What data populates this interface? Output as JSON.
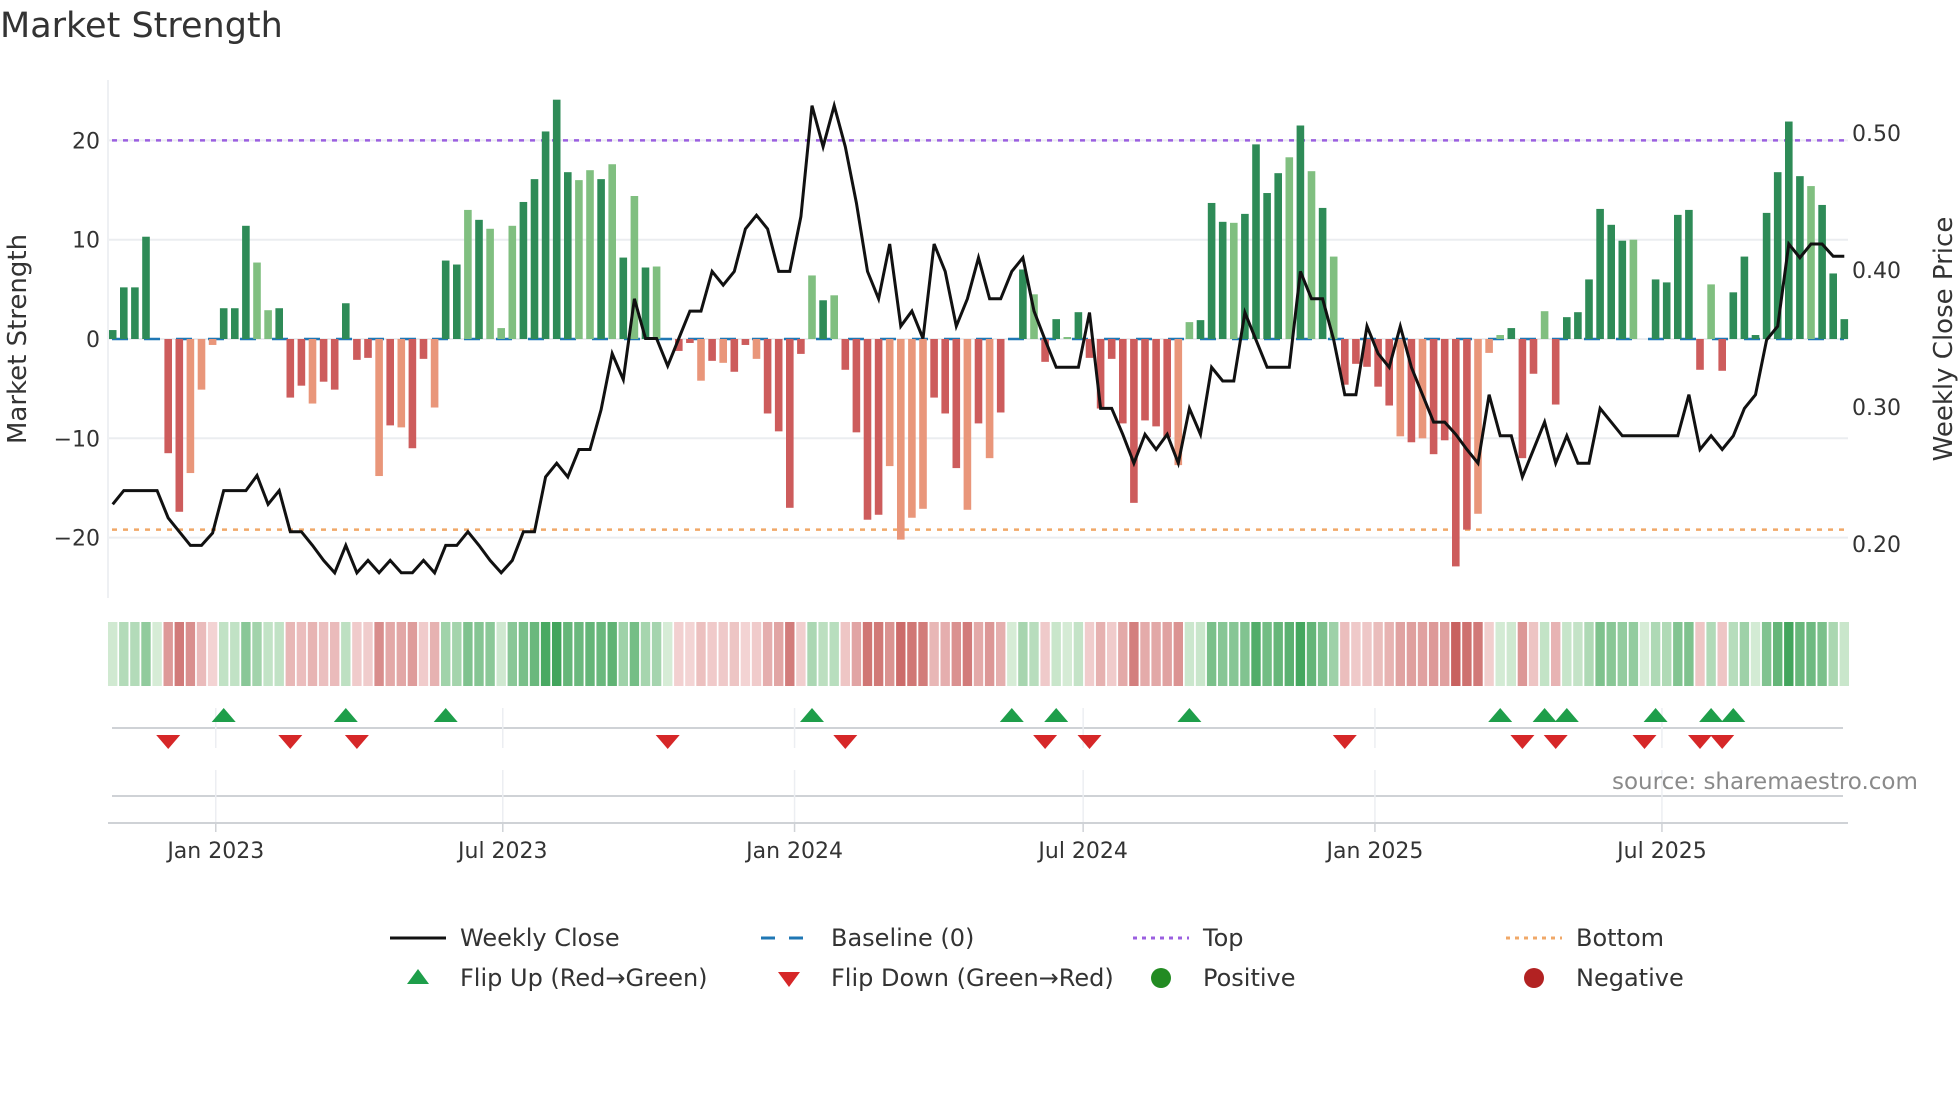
{
  "title": "Market Strength",
  "source": "source: sharemaestro.com",
  "colors": {
    "bar_pos_strong": "#2e8b57",
    "bar_pos_weak": "#80bf80",
    "bar_neg_strong": "#cd5c5c",
    "bar_neg_weak": "#e9967a",
    "line": "#111111",
    "baseline": "#1f77b4",
    "top": "#9b5fe0",
    "bottom": "#f0a868",
    "flip_up": "#1e9e4a",
    "flip_down": "#d62728",
    "positive": "#228b22",
    "negative": "#b22222",
    "grid": "#ebedf0"
  },
  "chart_data": {
    "type": "bar+line",
    "title": "Market Strength",
    "ylabel": "Market Strength",
    "y2label": "Weekly Close Price",
    "ylim": [
      -26.5,
      26.5
    ],
    "y2lim": [
      0.155,
      0.545
    ],
    "yticks": [
      {
        "value": 20,
        "label": "20"
      },
      {
        "value": 10,
        "label": "10"
      },
      {
        "value": 0,
        "label": "0"
      },
      {
        "value": -10,
        "label": "−10"
      },
      {
        "value": -20,
        "label": "−20"
      }
    ],
    "y2ticks": [
      {
        "value": 0.5,
        "label": "0.50"
      },
      {
        "value": 0.4,
        "label": "0.40"
      },
      {
        "value": 0.3,
        "label": "0.30"
      },
      {
        "value": 0.2,
        "label": "0.20"
      }
    ],
    "xticks": [
      {
        "date": "2023-01-01",
        "label": "Jan 2023"
      },
      {
        "date": "2023-07-01",
        "label": "Jul 2023"
      },
      {
        "date": "2024-01-01",
        "label": "Jan 2024"
      },
      {
        "date": "2024-07-01",
        "label": "Jul 2024"
      },
      {
        "date": "2025-01-01",
        "label": "Jan 2025"
      },
      {
        "date": "2025-07-01",
        "label": "Jul 2025"
      }
    ],
    "start_date": "2022-10-28",
    "interval_days": 7,
    "top_level": 20,
    "bottom_level": -19.2,
    "baseline": 0,
    "strength": [
      0.9,
      5.2,
      5.2,
      10.3,
      0,
      -11.5,
      -17.4,
      -13.5,
      -5.1,
      -0.6,
      3.1,
      3.1,
      11.4,
      7.7,
      2.9,
      3.1,
      -5.9,
      -4.7,
      -6.5,
      -4.3,
      -5.1,
      3.6,
      -2.1,
      -1.9,
      -13.8,
      -8.7,
      -8.9,
      -11.0,
      -2.0,
      -6.9,
      7.9,
      7.5,
      13.0,
      12.0,
      11.1,
      1.1,
      11.4,
      13.8,
      16.1,
      20.9,
      24.1,
      16.8,
      16.0,
      17.0,
      16.1,
      17.6,
      8.2,
      14.4,
      7.2,
      7.3,
      0,
      -1.2,
      -0.4,
      -4.2,
      -2.2,
      -2.4,
      -3.3,
      -0.6,
      -2.0,
      -7.5,
      -9.3,
      -17.0,
      -1.5,
      6.4,
      3.9,
      4.4,
      -3.1,
      -9.4,
      -18.2,
      -17.7,
      -12.8,
      -20.2,
      -18.0,
      -17.1,
      -5.9,
      -7.5,
      -13.0,
      -17.2,
      -8.5,
      -12.0,
      -7.4,
      0,
      7.0,
      4.5,
      -2.3,
      2.0,
      0.2,
      2.7,
      -1.9,
      -7.0,
      -2.0,
      -8.5,
      -16.5,
      -8.2,
      -8.8,
      -9.9,
      -12.7,
      1.7,
      1.9,
      13.7,
      11.8,
      11.7,
      12.6,
      19.6,
      14.7,
      16.7,
      18.3,
      21.5,
      16.9,
      13.2,
      8.3,
      -4.6,
      -2.5,
      -2.8,
      -4.8,
      -6.7,
      -9.8,
      -10.4,
      -10.0,
      -11.6,
      -10.2,
      -22.9,
      -19.2,
      -17.6,
      -1.4,
      0.4,
      1.1,
      -12.0,
      -3.5,
      2.8,
      -6.6,
      2.2,
      2.7,
      6.0,
      13.1,
      11.5,
      9.9,
      10.0,
      0,
      6.0,
      5.7,
      12.5,
      13.0,
      -3.1,
      5.5,
      -3.2,
      4.7,
      8.3,
      0.4,
      12.7,
      16.8,
      21.9,
      16.4,
      15.4,
      13.5,
      6.6,
      2.0
    ],
    "strength_shade": "dddddddllldddlldddldddddldlddlddldllldddddlldldldldddldlddlddddldlddddlllldddldldddlddldddddddddlldddlddddldldldddddldlddddllldddldddddddlldddddlddddddddldddlllll",
    "weekly_close": [
      0.229,
      0.239,
      0.239,
      0.239,
      0.239,
      0.219,
      0.209,
      0.199,
      0.199,
      0.208,
      0.239,
      0.239,
      0.239,
      0.25,
      0.229,
      0.239,
      0.209,
      0.209,
      0.199,
      0.188,
      0.179,
      0.199,
      0.179,
      0.188,
      0.179,
      0.188,
      0.179,
      0.179,
      0.188,
      0.179,
      0.199,
      0.199,
      0.209,
      0.199,
      0.188,
      0.179,
      0.188,
      0.209,
      0.209,
      0.249,
      0.259,
      0.249,
      0.269,
      0.269,
      0.298,
      0.339,
      0.32,
      0.379,
      0.35,
      0.35,
      0.33,
      0.35,
      0.37,
      0.37,
      0.399,
      0.389,
      0.399,
      0.43,
      0.44,
      0.43,
      0.399,
      0.399,
      0.439,
      0.52,
      0.49,
      0.52,
      0.49,
      0.449,
      0.399,
      0.379,
      0.419,
      0.359,
      0.37,
      0.35,
      0.419,
      0.399,
      0.359,
      0.379,
      0.409,
      0.379,
      0.379,
      0.399,
      0.409,
      0.37,
      0.349,
      0.329,
      0.329,
      0.329,
      0.369,
      0.299,
      0.299,
      0.28,
      0.259,
      0.28,
      0.269,
      0.28,
      0.259,
      0.299,
      0.28,
      0.329,
      0.319,
      0.319,
      0.369,
      0.349,
      0.329,
      0.329,
      0.329,
      0.399,
      0.379,
      0.379,
      0.349,
      0.309,
      0.309,
      0.359,
      0.339,
      0.329,
      0.359,
      0.329,
      0.309,
      0.289,
      0.289,
      0.28,
      0.269,
      0.259,
      0.309,
      0.279,
      0.279,
      0.249,
      0.269,
      0.289,
      0.259,
      0.279,
      0.259,
      0.259,
      0.299,
      0.289,
      0.279,
      0.279,
      0.279,
      0.279,
      0.279,
      0.279,
      0.309,
      0.269,
      0.279,
      0.269,
      0.279,
      0.299,
      0.309,
      0.349,
      0.359,
      0.419,
      0.409,
      0.419,
      0.419,
      0.41,
      0.41
    ],
    "flip_up_weeks": [
      10,
      21,
      30,
      63,
      81,
      85,
      97,
      125,
      129,
      131,
      139,
      144,
      146
    ],
    "flip_down_weeks": [
      5,
      16,
      22,
      50,
      66,
      84,
      88,
      111,
      127,
      130,
      138,
      143,
      145
    ]
  },
  "legend": [
    {
      "label": "Weekly Close",
      "symbol": "solid-line"
    },
    {
      "label": "Baseline (0)",
      "symbol": "dashed-line"
    },
    {
      "label": "Top",
      "symbol": "dotted-line-top"
    },
    {
      "label": "Bottom",
      "symbol": "dotted-line-bottom"
    },
    {
      "label": "Flip Up (Red→Green)",
      "symbol": "triangle-up"
    },
    {
      "label": "Flip Down (Green→Red)",
      "symbol": "triangle-down"
    },
    {
      "label": "Positive",
      "symbol": "dot-positive"
    },
    {
      "label": "Negative",
      "symbol": "dot-negative"
    }
  ]
}
